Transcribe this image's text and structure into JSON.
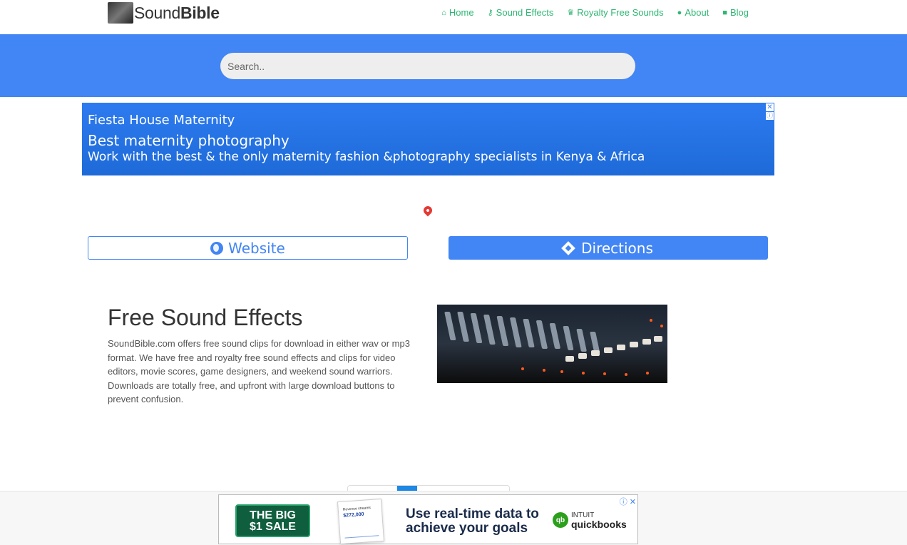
{
  "brand": {
    "name_light": "Sound",
    "name_bold": "Bible"
  },
  "nav": [
    {
      "icon": "home-icon",
      "label": "Home"
    },
    {
      "icon": "key-icon",
      "label": "Sound Effects"
    },
    {
      "icon": "crown-icon",
      "label": "Royalty Free Sounds"
    },
    {
      "icon": "info-icon",
      "label": "About"
    },
    {
      "icon": "blogger-icon",
      "label": "Blog"
    }
  ],
  "search": {
    "placeholder": "Search.."
  },
  "ad_top": {
    "line1": "Fiesta House Maternity",
    "line2": "Best maternity photography",
    "line3": "Work with the best & the only maternity fashion &photography specialists in Kenya & Africa",
    "close": "✕",
    "info": "ⓘ"
  },
  "buttons": {
    "website": "Website",
    "directions": "Directions"
  },
  "main": {
    "title": "Free Sound Effects",
    "description": "SoundBible.com offers free sound clips for download in either wav or mp3 format. We have free and royalty free sound effects and clips for video editors, movie scores, game designers, and weekend sound warriors. Downloads are totally free, and upfront with large download buttons to prevent confusion."
  },
  "ad_bottom": {
    "sale_line1": "THE BIG",
    "sale_line2": "$1 SALE",
    "chart_title": "Revenue streams",
    "chart_value": "$272,000",
    "headline_line1": "Use real-time data to",
    "headline_line2": "achieve your goals",
    "brand_top": "INTUIT",
    "brand_main": "quickbooks",
    "qb_mark": "qb",
    "icons": "ⓘ ✕"
  },
  "colors": {
    "accent": "#4285f4",
    "nav_green": "#2fb673",
    "text": "#333333"
  }
}
